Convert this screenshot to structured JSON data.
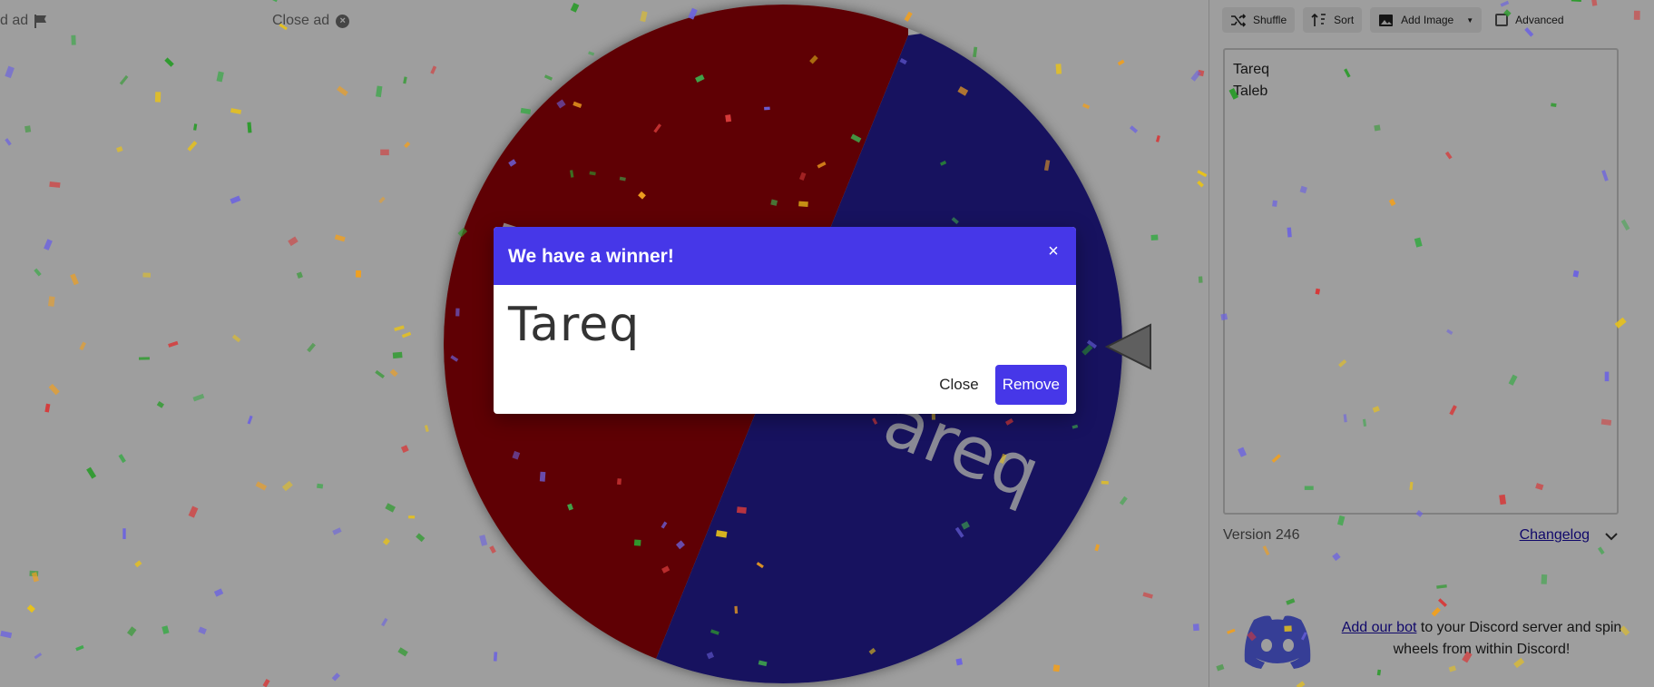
{
  "ad": {
    "report_label": "d ad",
    "close_label": "Close ad"
  },
  "wheel": {
    "segment_labels": [
      "Ta",
      "areq"
    ],
    "segment_colors": [
      "#9a0008",
      "#261e9a"
    ]
  },
  "toolbar": {
    "shuffle_label": "Shuffle",
    "sort_label": "Sort",
    "add_image_label": "Add Image",
    "advanced_label": "Advanced"
  },
  "entries": [
    "Tareq",
    "Taleb"
  ],
  "footer": {
    "version": "Version 246",
    "changelog": "Changelog"
  },
  "discord": {
    "link_text": "Add our bot",
    "text": " to your Discord server and spin wheels from within Discord!"
  },
  "modal": {
    "title": "We have a winner!",
    "close_x": "×",
    "winner": "Tareq",
    "close_label": "Close",
    "remove_label": "Remove"
  },
  "colors": {
    "accent": "#4637e8",
    "wheel_red": "#9a0008",
    "wheel_blue": "#261e9a",
    "discord": "#5865f2"
  }
}
